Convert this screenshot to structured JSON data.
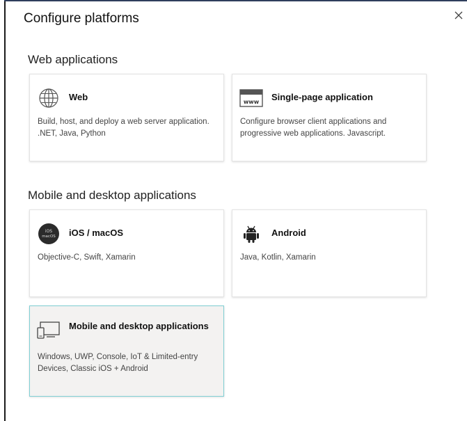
{
  "dialog": {
    "title": "Configure platforms",
    "close_glyph": "×"
  },
  "sections": {
    "web": {
      "heading": "Web applications",
      "cards": [
        {
          "name": "Web",
          "description": "Build, host, and deploy a web server application. .NET, Java, Python",
          "icon": "globe-icon"
        },
        {
          "name": "Single-page application",
          "description": "Configure browser client applications and progressive web applications. Javascript.",
          "icon": "www-icon"
        }
      ]
    },
    "mobile": {
      "heading": "Mobile and desktop applications",
      "cards": [
        {
          "name": "iOS / macOS",
          "description": "Objective-C, Swift, Xamarin",
          "icon": "apple-ios-icon",
          "icon_text": "iOS macOS"
        },
        {
          "name": "Android",
          "description": "Java, Kotlin, Xamarin",
          "icon": "android-icon"
        },
        {
          "name": "Mobile and desktop applications",
          "description": "Windows, UWP, Console, IoT & Limited-entry Devices, Classic iOS + Android",
          "icon": "desktop-mobile-icon",
          "selected": true
        }
      ]
    }
  },
  "colors": {
    "selected_border": "#7fcfd4",
    "selected_background": "#f3f2f1"
  }
}
